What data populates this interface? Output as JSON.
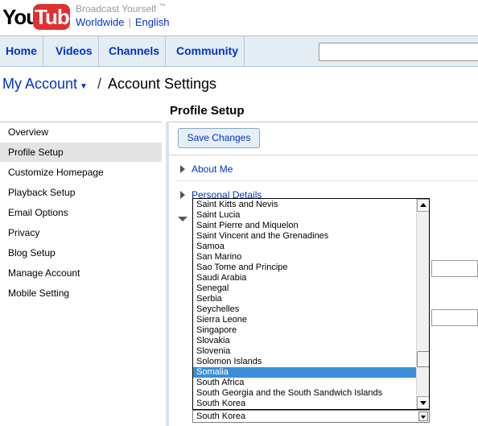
{
  "header": {
    "logo_you": "You",
    "logo_tube": "Tube",
    "slogan": "Broadcast Yourself",
    "slogan_tm": "™",
    "region": "Worldwide",
    "language": "English"
  },
  "nav": {
    "tabs": [
      {
        "label": "Home"
      },
      {
        "label": "Videos"
      },
      {
        "label": "Channels"
      },
      {
        "label": "Community"
      }
    ],
    "search_value": ""
  },
  "breadcrumb": {
    "parent": "My Account",
    "caret": "▼",
    "separator": "/",
    "current": "Account Settings"
  },
  "section_title": "Profile Setup",
  "sidebar": {
    "items": [
      {
        "label": "Overview"
      },
      {
        "label": "Profile Setup"
      },
      {
        "label": "Customize Homepage"
      },
      {
        "label": "Playback Setup"
      },
      {
        "label": "Email Options"
      },
      {
        "label": "Privacy"
      },
      {
        "label": "Blog Setup"
      },
      {
        "label": "Manage Account"
      },
      {
        "label": "Mobile Setting"
      }
    ],
    "active": "Profile Setup"
  },
  "main": {
    "save_label": "Save Changes",
    "sections": [
      {
        "label": "About Me"
      },
      {
        "label": "Personal Details"
      }
    ]
  },
  "country_dropdown": {
    "options": [
      "Saint Kitts and Nevis",
      "Saint Lucia",
      "Saint Pierre and Miquelon",
      "Saint Vincent and the Grenadines",
      "Samoa",
      "San Marino",
      "Sao Tome and Principe",
      "Saudi Arabia",
      "Senegal",
      "Serbia",
      "Seychelles",
      "Sierra Leone",
      "Singapore",
      "Slovakia",
      "Slovenia",
      "Solomon Islands",
      "Somalia",
      "South Africa",
      "South Georgia and the South Sandwich Islands",
      "South Korea"
    ],
    "highlighted": "Somalia",
    "selected_value": "South Korea"
  },
  "colors": {
    "link": "#0033cc",
    "nav_bg": "#e4ecf4",
    "highlight": "#3a8fd8",
    "logo_red": "#e02f2f"
  }
}
